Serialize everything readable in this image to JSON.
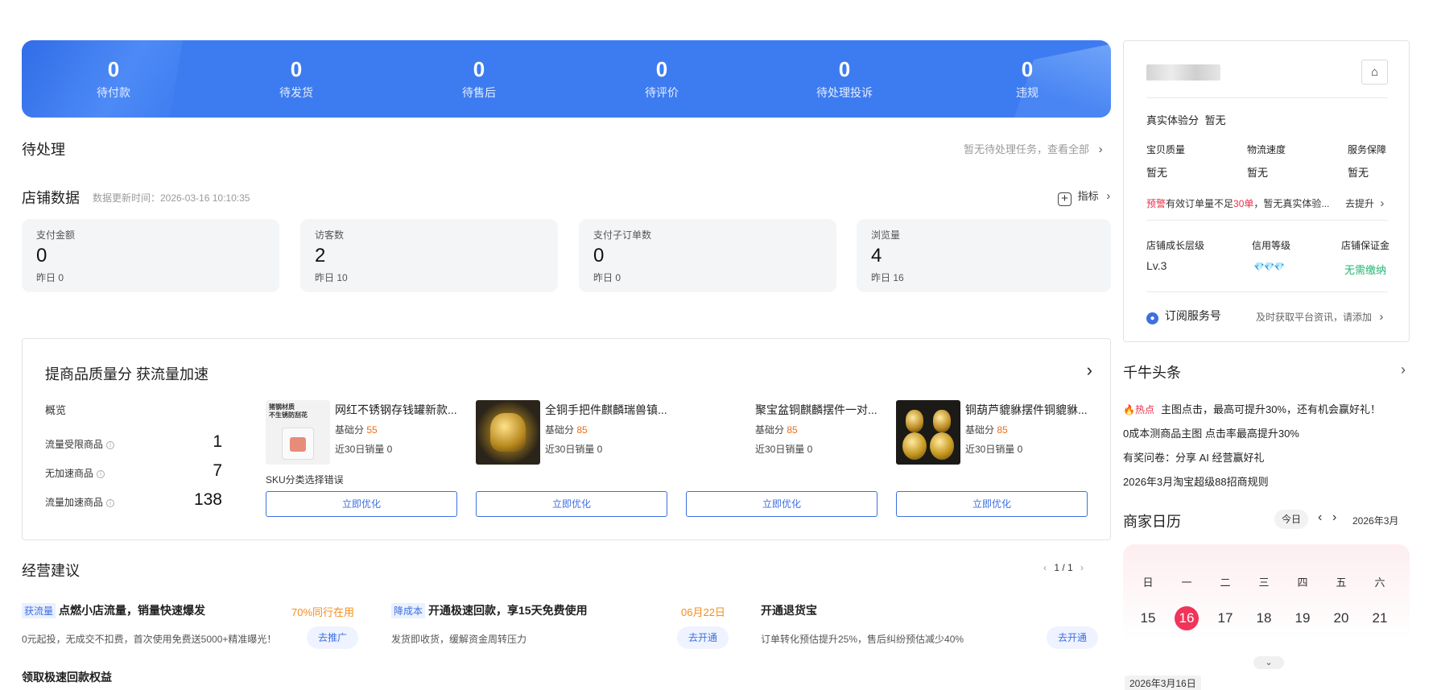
{
  "status_bar": {
    "items": [
      {
        "value": "0",
        "label": "待付款"
      },
      {
        "value": "0",
        "label": "待发货"
      },
      {
        "value": "0",
        "label": "待售后"
      },
      {
        "value": "0",
        "label": "待评价"
      },
      {
        "value": "0",
        "label": "待处理投诉"
      },
      {
        "value": "0",
        "label": "违规"
      }
    ]
  },
  "pending": {
    "title": "待处理",
    "link": "暂无待处理任务，查看全部"
  },
  "shop_data": {
    "title": "店铺数据",
    "update_time": "数据更新时间：2026-03-16 10:10:35",
    "indicator_label": "指标",
    "metrics": [
      {
        "label": "支付金额",
        "value": "0",
        "prev": "昨日 0"
      },
      {
        "label": "访客数",
        "value": "2",
        "prev": "昨日 10"
      },
      {
        "label": "支付子订单数",
        "value": "0",
        "prev": "昨日 0"
      },
      {
        "label": "浏览量",
        "value": "4",
        "prev": "昨日 16"
      }
    ]
  },
  "quality": {
    "title": "提商品质量分 获流量加速",
    "overview_label": "概览",
    "rows": [
      {
        "label": "流量受限商品",
        "value": "1"
      },
      {
        "label": "无加速商品",
        "value": "7"
      },
      {
        "label": "流量加速商品",
        "value": "138"
      }
    ],
    "products": [
      {
        "name": "网红不锈钢存钱罐新款...",
        "score_label": "基础分",
        "score": "55",
        "sales": "近30日销量 0",
        "note": "SKU分类选择错误",
        "button": "立即优化",
        "thumb_text": "猪钢材质\n不生锈防刮花"
      },
      {
        "name": "全铜手把件麒麟瑞兽镇...",
        "score_label": "基础分",
        "score": "85",
        "sales": "近30日销量 0",
        "note": "",
        "button": "立即优化"
      },
      {
        "name": "聚宝盆铜麒麟摆件一对...",
        "score_label": "基础分",
        "score": "85",
        "sales": "近30日销量 0",
        "note": "",
        "button": "立即优化"
      },
      {
        "name": "铜葫芦貔貅摆件铜貔貅...",
        "score_label": "基础分",
        "score": "85",
        "sales": "近30日销量 0",
        "note": "",
        "button": "立即优化"
      }
    ]
  },
  "advice": {
    "title": "经营建议",
    "pager": "1 / 1",
    "items": [
      {
        "tag": "获流量",
        "title": "点燃小店流量，销量快速爆发",
        "highlight": "70%同行在用",
        "desc": "0元起投，无成交不扣费，首次使用免费送5000+精准曝光！",
        "button": "去推广"
      },
      {
        "tag": "降成本",
        "title": "开通极速回款，享15天免费使用",
        "highlight": "06月22日",
        "desc": "发货即收货，缓解资金周转压力",
        "button": "去开通"
      },
      {
        "tag": "",
        "title": "开通退货宝",
        "highlight": "",
        "desc": "订单转化预估提升25%，售后纠纷预估减少40%",
        "button": "去开通"
      }
    ],
    "next_title": "领取极速回款权益"
  },
  "shop_card": {
    "experience_label": "真实体验分",
    "experience_value": "暂无",
    "sub_scores": [
      {
        "label": "宝贝质量",
        "value": "暂无"
      },
      {
        "label": "物流速度",
        "value": "暂无"
      },
      {
        "label": "服务保障",
        "value": "暂无"
      }
    ],
    "warning_tag": "预警",
    "warning_text_1": "有效订单量不足",
    "warning_highlight": "30单",
    "warning_text_2": "，暂无真实体验...",
    "warning_link": "去提升",
    "levels": [
      {
        "label": "店铺成长层级",
        "value": "Lv.3"
      },
      {
        "label": "信用等级",
        "value": "💎💎💎"
      },
      {
        "label": "店铺保证金",
        "value": "无需缴纳"
      }
    ],
    "subscribe_label": "订阅服务号",
    "subscribe_hint": "及时获取平台资讯，请添加"
  },
  "headlines": {
    "title": "千牛头条",
    "hot_tag": "热点",
    "items": [
      "主图点击，最高可提升30%，还有机会赢好礼！",
      "0成本测商品主图 点击率最高提升30%",
      "有奖问卷：分享 AI 经营赢好礼",
      "2026年3月淘宝超级88招商规则"
    ]
  },
  "calendar": {
    "title": "商家日历",
    "today_label": "今日",
    "month_label": "2026年3月",
    "weekdays": [
      "日",
      "一",
      "二",
      "三",
      "四",
      "五",
      "六"
    ],
    "days": [
      "15",
      "16",
      "17",
      "18",
      "19",
      "20",
      "21"
    ],
    "selected_date": "2026年3月16日"
  },
  "colors": {
    "primary": "#3d7cf0",
    "accent_orange": "#f06a1b",
    "danger": "#e8304a",
    "success": "#22b573"
  }
}
